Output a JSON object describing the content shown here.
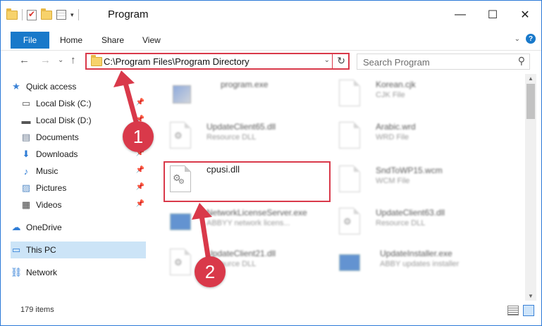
{
  "window": {
    "title": "Program",
    "controls": {
      "minimize": "—",
      "maximize": "☐",
      "close": "✕"
    }
  },
  "ribbon": {
    "tabs": [
      {
        "label": "File",
        "active": true
      },
      {
        "label": "Home"
      },
      {
        "label": "Share"
      },
      {
        "label": "View"
      }
    ],
    "help_icon": "?"
  },
  "navigation": {
    "back": "←",
    "forward": "→",
    "recent": "⌄",
    "up": "↑",
    "address": "C:\\Program Files\\Program Directory",
    "search_placeholder": "Search Program"
  },
  "sidebar": {
    "items": [
      {
        "label": "Quick access",
        "icon": "star-icon",
        "glyph": "★",
        "color": "#3b82d6",
        "pinned": false
      },
      {
        "label": "Local Disk (C:)",
        "icon": "drive-icon",
        "glyph": "▭",
        "color": "#555555",
        "pinned": true
      },
      {
        "label": "Local Disk (D:)",
        "icon": "drive-icon",
        "glyph": "▬",
        "color": "#555555",
        "pinned": true
      },
      {
        "label": "Documents",
        "icon": "documents-icon",
        "glyph": "▤",
        "color": "#6b7a8f",
        "pinned": true
      },
      {
        "label": "Downloads",
        "icon": "download-icon",
        "glyph": "⬇",
        "color": "#2f7dd6",
        "pinned": true
      },
      {
        "label": "Music",
        "icon": "music-icon",
        "glyph": "♪",
        "color": "#2f7dd6",
        "pinned": true
      },
      {
        "label": "Pictures",
        "icon": "pictures-icon",
        "glyph": "▨",
        "color": "#5a8fc9",
        "pinned": true
      },
      {
        "label": "Videos",
        "icon": "videos-icon",
        "glyph": "▦",
        "color": "#444444",
        "pinned": true
      },
      {
        "label": "OneDrive",
        "icon": "cloud-icon",
        "glyph": "☁",
        "color": "#2f7dd6",
        "pinned": false
      },
      {
        "label": "This PC",
        "icon": "computer-icon",
        "glyph": "▭",
        "color": "#2f7dd6",
        "pinned": false,
        "selected": true
      },
      {
        "label": "Network",
        "icon": "network-icon",
        "glyph": "⛓",
        "color": "#2f7dd6",
        "pinned": false
      }
    ]
  },
  "files": [
    {
      "name": "program.exe",
      "type": "",
      "icon": "program-exe-icon",
      "blurred": true
    },
    {
      "name": "Korean.cjk",
      "type": "CJK File",
      "icon": "file-icon",
      "blurred": true
    },
    {
      "name": "UpdateClient65.dll",
      "type": "Resource DLL",
      "icon": "dll-icon",
      "blurred": true
    },
    {
      "name": "Arabic.wrd",
      "type": "WRD File",
      "icon": "file-icon",
      "blurred": true
    },
    {
      "name": "cpusi.dll",
      "type": "",
      "icon": "dll-icon",
      "blurred": false
    },
    {
      "name": "SndToWP15.wcm",
      "type": "WCM File",
      "icon": "file-icon",
      "blurred": true
    },
    {
      "name": "NetworkLicenseServer.exe",
      "type": "ABBYY network licens...",
      "icon": "app-icon",
      "blurred": true
    },
    {
      "name": "UpdateClient63.dll",
      "type": "Resource DLL",
      "icon": "dll-icon",
      "blurred": true
    },
    {
      "name": "UpdateClient21.dll",
      "type": "Resource DLL",
      "icon": "dll-icon",
      "blurred": true
    },
    {
      "name": "UpdateInstaller.exe",
      "type": "ABBY updates installer",
      "icon": "app-icon",
      "blurred": true
    }
  ],
  "status": {
    "item_count": "179 items"
  },
  "annotations": {
    "step1": "1",
    "step2": "2",
    "color": "#d9394a"
  }
}
